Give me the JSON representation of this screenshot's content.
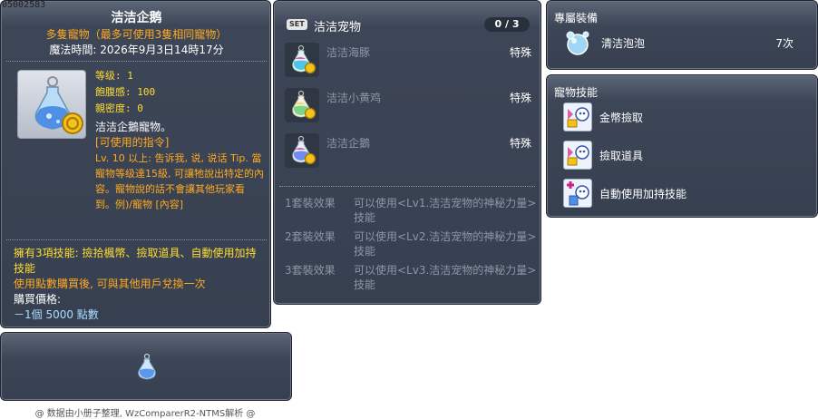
{
  "item_id": "05002583",
  "main": {
    "title": "洁洁企鹅",
    "subtitle": "多隻寵物（最多可使用3隻相同寵物）",
    "magic_time": "魔法時間: 2026年9月3日14時17分",
    "stats": [
      {
        "label": "等级:",
        "value": "1"
      },
      {
        "label": "飽腹感:",
        "value": "100"
      },
      {
        "label": "親密度:",
        "value": "0"
      }
    ],
    "desc_line": "洁洁企鵝寵物。",
    "cmd_title": "[可使用的指令]",
    "cmd_body": "Lv. 10 以上: 吿诉我, 说, 说话 Tip. 當寵物等级達15級, 可讓牠說出特定的內容。寵物說的話不會讓其他玩家看到。例)/寵物 [內容]",
    "skills_note": "擁有3項技能: 撿拾楓幣、撿取道具、自動使用加持技能",
    "trade_note": "使用點數購買後, 可與其他用戶兌換一次",
    "price_label": "購買價格:",
    "price_value": "－1個 5000 點數"
  },
  "footer": "@ 数据由小册子整理, WzComparerR2-NTMS解析 @",
  "set": {
    "tag": "SET",
    "title": "洁洁宠物",
    "count": "0 / 3",
    "items": [
      {
        "name": "洁洁海豚",
        "type": "特殊",
        "color": "#4fc3e8"
      },
      {
        "name": "洁洁小黄鸡",
        "type": "特殊",
        "color": "#f2d94a"
      },
      {
        "name": "洁洁企鵝",
        "type": "特殊",
        "color": "#6f8cf0"
      }
    ],
    "effects": [
      {
        "label": "1套裝效果",
        "text": "可以使用<Lv1.洁洁宠物的神秘力量>技能"
      },
      {
        "label": "2套裝效果",
        "text": "可以使用<Lv2.洁洁宠物的神秘力量>技能"
      },
      {
        "label": "3套裝效果",
        "text": "可以使用<Lv3.洁洁宠物的神秘力量>技能"
      }
    ]
  },
  "equip": {
    "title": "專屬裝備",
    "item_name": "清洁泡泡",
    "item_count": "7次"
  },
  "skills": {
    "title": "寵物技能",
    "items": [
      {
        "name": "金幣撿取"
      },
      {
        "name": "撿取道具"
      },
      {
        "name": "自動使用加持技能"
      }
    ]
  },
  "colors": {
    "panel_bg": "#3d4656",
    "gold": "#ffdd33",
    "orange": "#ffaa22",
    "muted": "#8d97a6",
    "price_blue": "#aaddff"
  }
}
